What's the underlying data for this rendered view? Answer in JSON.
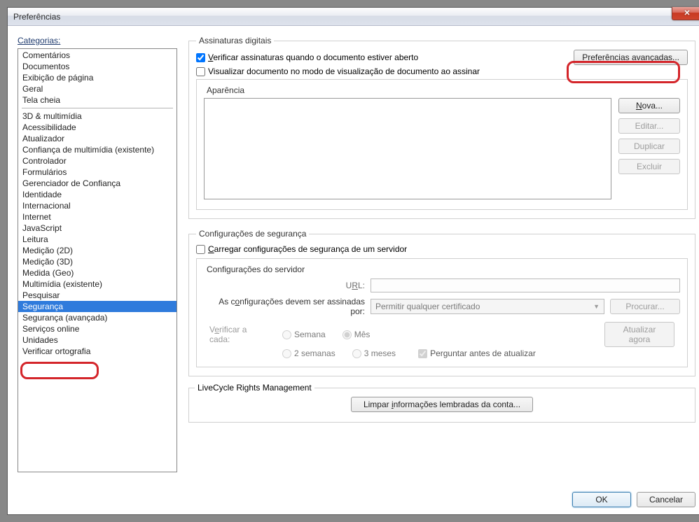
{
  "window": {
    "title": "Preferências"
  },
  "sidebar": {
    "label": "Categorias:",
    "group1": [
      "Comentários",
      "Documentos",
      "Exibição de página",
      "Geral",
      "Tela cheia"
    ],
    "group2": [
      "3D & multimídia",
      "Acessibilidade",
      "Atualizador",
      "Confiança de multimídia (existente)",
      "Controlador",
      "Formulários",
      "Gerenciador de Confiança",
      "Identidade",
      "Internacional",
      "Internet",
      "JavaScript",
      "Leitura",
      "Medição (2D)",
      "Medição (3D)",
      "Medida (Geo)",
      "Multimídia (existente)",
      "Pesquisar",
      "Segurança",
      "Segurança (avançada)",
      "Serviços online",
      "Unidades",
      "Verificar ortografia"
    ],
    "selected": "Segurança"
  },
  "digital_sig": {
    "legend": "Assinaturas digitais",
    "verify_label": "Verificar assinaturas quando o documento estiver aberto",
    "view_label": "Visualizar documento no modo de visualização de documento ao assinar",
    "advanced_btn": "Preferências avançadas...",
    "appearance_legend": "Aparência",
    "btn_new": "Nova...",
    "btn_edit": "Editar...",
    "btn_dup": "Duplicar",
    "btn_del": "Excluir"
  },
  "sec_settings": {
    "legend": "Configurações de segurança",
    "load_label": "Carregar configurações de segurança de um servidor",
    "server_legend": "Configurações do servidor",
    "url_label": "URL:",
    "signed_by": "As configurações devem ser assinadas por:",
    "signed_value": "Permitir qualquer certificado",
    "browse": "Procurar...",
    "verify_each": "Verificar a cada:",
    "r_week": "Semana",
    "r_month": "Mês",
    "r_2weeks": "2 semanas",
    "r_3months": "3 meses",
    "ask_before": "Perguntar antes de atualizar",
    "update_now": "Atualizar agora"
  },
  "lcrm": {
    "legend": "LiveCycle Rights Management",
    "clear_btn": "Limpar informações lembradas da conta..."
  },
  "footer": {
    "ok": "OK",
    "cancel": "Cancelar"
  }
}
